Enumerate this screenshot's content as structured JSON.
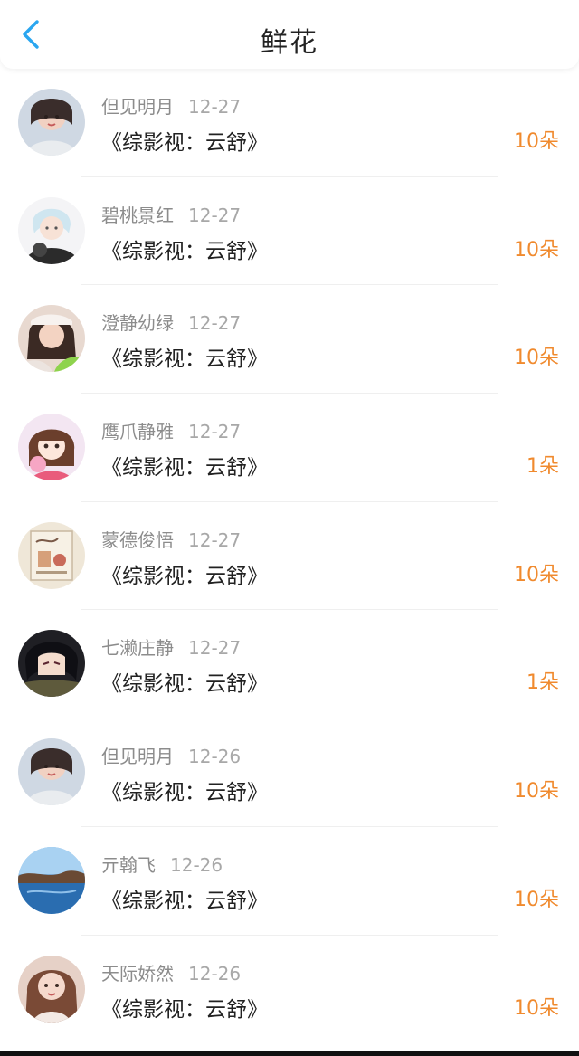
{
  "header": {
    "title": "鲜花",
    "back_icon": "chevron-left-icon",
    "accent_color": "#2aa6f0"
  },
  "records": [
    {
      "user": "但见明月",
      "date": "12-27",
      "book": "《综影视：云舒》",
      "amount": "10朵",
      "avatar": "portrait-icon"
    },
    {
      "user": "碧桃景红",
      "date": "12-27",
      "book": "《综影视：云舒》",
      "amount": "10朵",
      "avatar": "anime-boy-icon"
    },
    {
      "user": "澄静幼绿",
      "date": "12-27",
      "book": "《综影视：云舒》",
      "amount": "10朵",
      "avatar": "portrait-icon"
    },
    {
      "user": "鹰爪静雅",
      "date": "12-27",
      "book": "《综影视：云舒》",
      "amount": "1朵",
      "avatar": "cartoon-girl-icon"
    },
    {
      "user": "蒙德俊悟",
      "date": "12-27",
      "book": "《综影视：云舒》",
      "amount": "10朵",
      "avatar": "poster-icon"
    },
    {
      "user": "七濑庄静",
      "date": "12-27",
      "book": "《综影视：云舒》",
      "amount": "1朵",
      "avatar": "anime-man-icon"
    },
    {
      "user": "但见明月",
      "date": "12-26",
      "book": "《综影视：云舒》",
      "amount": "10朵",
      "avatar": "portrait-icon"
    },
    {
      "user": "亓翰飞",
      "date": "12-26",
      "book": "《综影视：云舒》",
      "amount": "10朵",
      "avatar": "landscape-icon"
    },
    {
      "user": "天际娇然",
      "date": "12-26",
      "book": "《综影视：云舒》",
      "amount": "10朵",
      "avatar": "portrait-icon"
    }
  ],
  "colors": {
    "amount": "#f08a2e",
    "meta": "#8c8c8c",
    "text": "#222222"
  }
}
